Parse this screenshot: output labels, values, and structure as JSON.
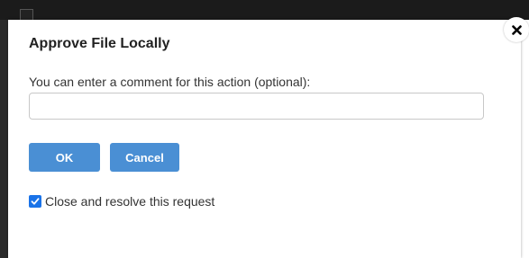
{
  "dialog": {
    "title": "Approve File Locally",
    "comment_prompt": "You can enter a comment for this action (optional):",
    "comment_value": "",
    "comment_placeholder": "",
    "ok_label": "OK",
    "cancel_label": "Cancel",
    "resolve_checkbox_label": "Close and resolve this request",
    "resolve_checkbox_checked": true,
    "close_icon": "close-icon"
  },
  "colors": {
    "primary_button": "#4a8fd4",
    "checkbox_accent": "#1a73e8",
    "title_text": "#222222",
    "body_text": "#333333",
    "backdrop_dark": "#1b1b1b"
  }
}
